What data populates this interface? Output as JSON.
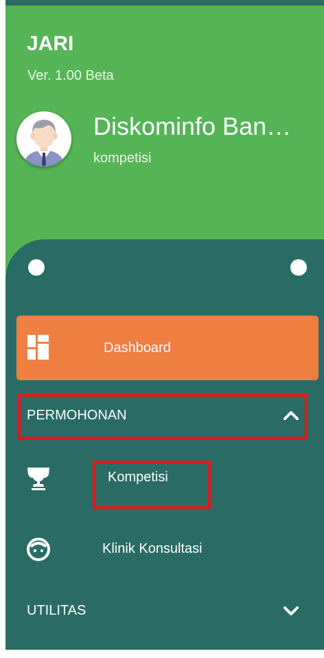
{
  "app": {
    "title": "JARI",
    "version": "Ver. 1.00 Beta"
  },
  "user": {
    "name": "Diskominfo Ban…",
    "role": "kompetisi"
  },
  "menu": {
    "dashboard": {
      "label": "Dashboard",
      "icon": "dashboard-icon"
    },
    "sections": [
      {
        "label": "PERMOHONAN",
        "expanded": true,
        "chevron": "chevron-up-icon",
        "items": [
          {
            "label": "Kompetisi",
            "icon": "trophy-icon"
          },
          {
            "label": "Klinik Konsultasi",
            "icon": "consultation-icon"
          }
        ]
      },
      {
        "label": "UTILITAS",
        "expanded": false,
        "chevron": "chevron-down-icon",
        "items": []
      }
    ]
  },
  "colors": {
    "header_green": "#55b556",
    "panel_teal": "#2a6b65",
    "dashboard_orange": "#ee7f41",
    "highlight_red": "#e8131b"
  }
}
